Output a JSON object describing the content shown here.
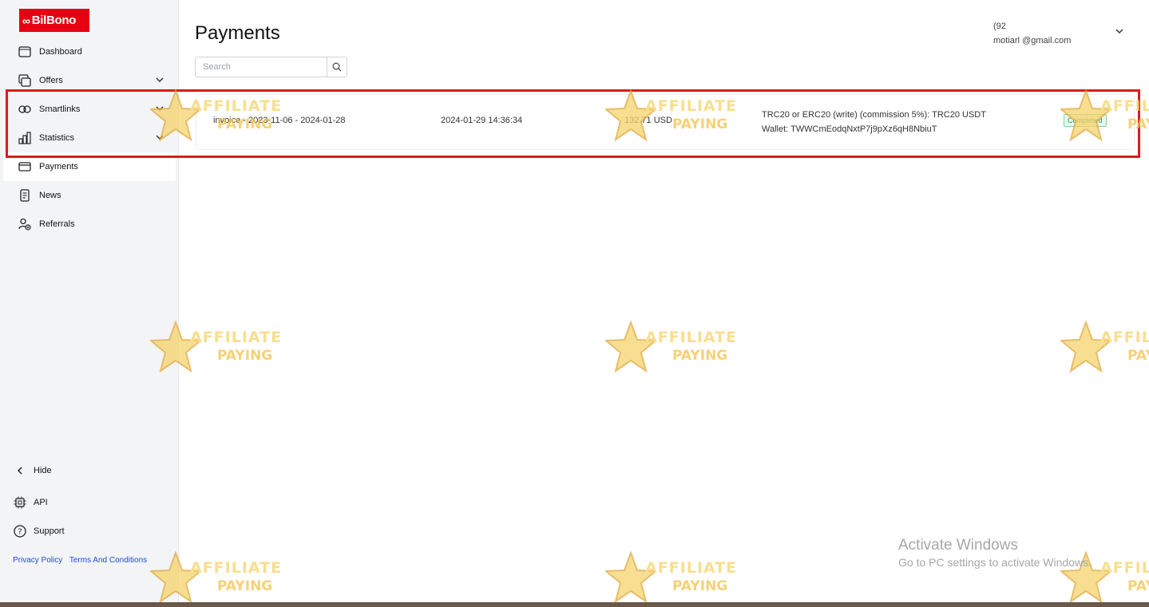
{
  "brand": {
    "logo_text": "BilBono",
    "color": "#e60012"
  },
  "sidebar": {
    "items": [
      {
        "label": "Dashboard",
        "icon": "dashboard-icon"
      },
      {
        "label": "Offers",
        "icon": "offers-icon",
        "expandable": true
      },
      {
        "label": "Smartlinks",
        "icon": "link-icon",
        "expandable": true
      },
      {
        "label": "Statistics",
        "icon": "bar-chart-icon",
        "expandable": true
      },
      {
        "label": "Payments",
        "icon": "card-icon",
        "active": true
      },
      {
        "label": "News",
        "icon": "news-icon"
      },
      {
        "label": "Referrals",
        "icon": "referrals-icon"
      }
    ],
    "hide_label": "Hide",
    "api_label": "API",
    "support_label": "Support",
    "privacy_label": "Privacy Policy",
    "terms_label": "Terms And Conditions"
  },
  "header": {
    "title": "Payments",
    "user_phone": "(92",
    "user_email": "motiarl          @gmail.com"
  },
  "search": {
    "placeholder": "Search"
  },
  "payments": [
    {
      "name": "invoice - 2023-11-06 - 2024-01-28",
      "date": "2024-01-29 14:36:34",
      "amount": "132.71 USD",
      "method_line1": "TRC20 or ERC20 (write) (commission 5%): TRC20 USDT",
      "method_line2": "Wallet: TWWCmEodqNxtP7j9pXz6qH8NbiuT",
      "status": "Completed"
    }
  ],
  "watermark": {
    "line1": "AFFILIATE",
    "line2": "PAYING"
  },
  "activation": {
    "line1": "Activate Windows",
    "line2": "Go to PC settings to activate Windows."
  }
}
